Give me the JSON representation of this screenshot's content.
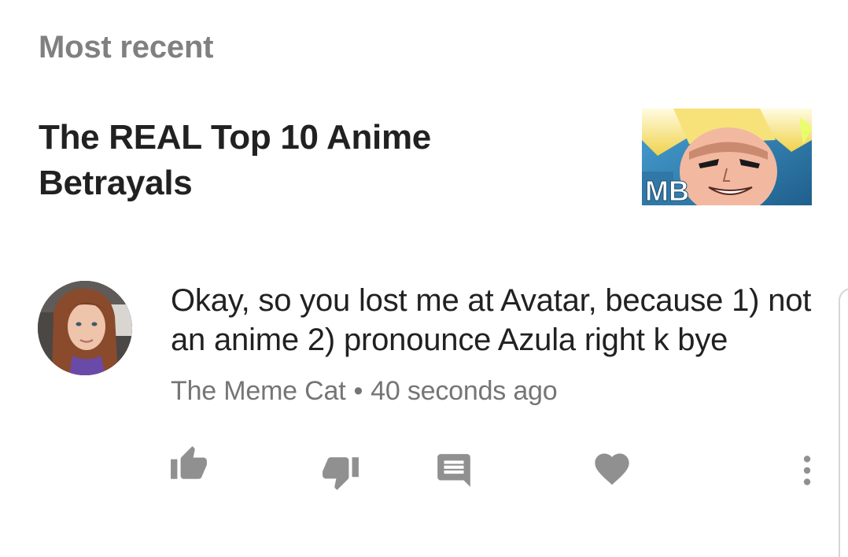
{
  "section": {
    "label": "Most recent"
  },
  "video": {
    "title": "The REAL Top 10 Anime Betrayals",
    "thumbnail_logo": "MB",
    "thumbnail_icon": "video-thumbnail"
  },
  "comment": {
    "text": "Okay, so you lost me at Avatar, because 1) not an anime 2) pronounce Azula right k bye",
    "author": "The Meme Cat",
    "separator": "•",
    "time": "40 seconds ago"
  },
  "actions": {
    "like_icon": "thumbs-up-icon",
    "dislike_icon": "thumbs-down-icon",
    "reply_icon": "comment-icon",
    "heart_icon": "heart-icon",
    "more_icon": "more-vertical-icon"
  },
  "colors": {
    "icon": "#909090",
    "title": "#212121",
    "meta": "#757575",
    "section": "#808080"
  }
}
